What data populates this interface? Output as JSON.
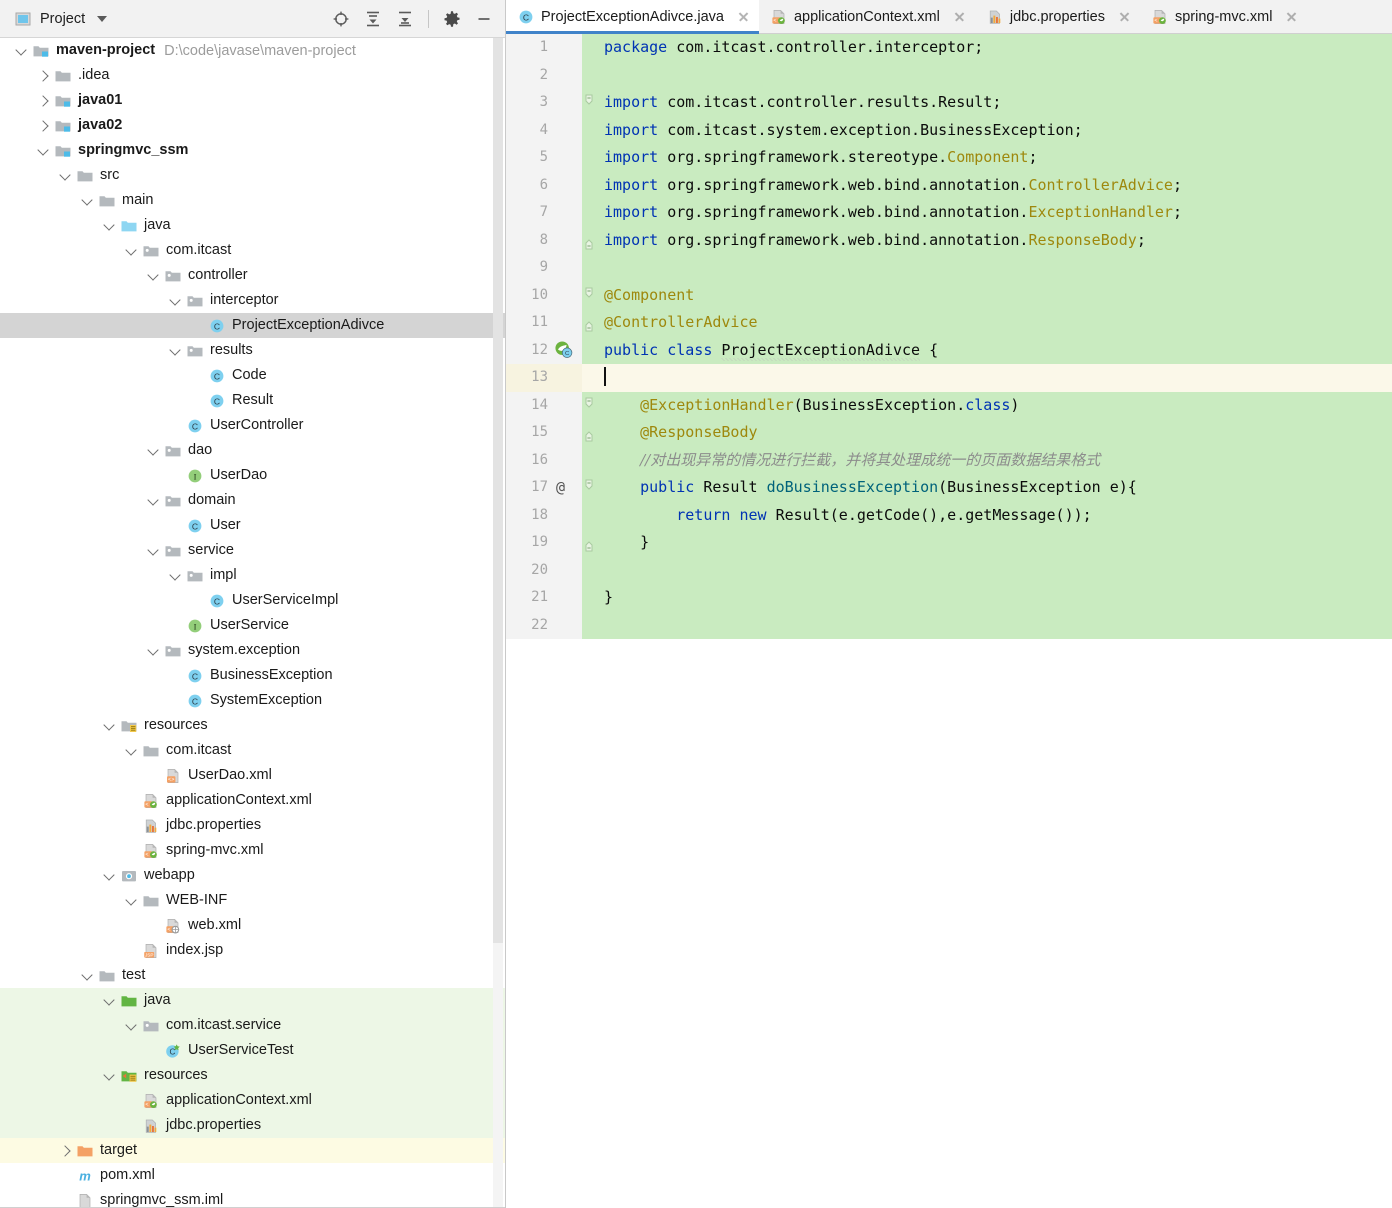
{
  "project_panel": {
    "header": {
      "title": "Project",
      "icon": "project-window-icon",
      "dropdown_icon": "chevron-down-icon",
      "tools": [
        {
          "name": "locate-in-tree-icon",
          "label": "Select Opened File"
        },
        {
          "name": "expand-all-icon",
          "label": "Expand All"
        },
        {
          "name": "collapse-all-icon",
          "label": "Collapse All"
        },
        {
          "name": "settings-gear-icon",
          "label": "Settings"
        },
        {
          "name": "hide-panel-icon",
          "label": "Hide"
        }
      ]
    },
    "tree": [
      {
        "label": "maven-project",
        "path": "D:\\code\\javase\\maven-project",
        "depth": 0,
        "twisty": "open",
        "icon": "module-folder-icon",
        "bold": true,
        "tint": ""
      },
      {
        "label": ".idea",
        "path": "",
        "depth": 1,
        "twisty": "closed",
        "icon": "folder-icon",
        "bold": false,
        "tint": ""
      },
      {
        "label": "java01",
        "path": "",
        "depth": 1,
        "twisty": "closed",
        "icon": "module-folder-icon",
        "bold": true,
        "tint": ""
      },
      {
        "label": "java02",
        "path": "",
        "depth": 1,
        "twisty": "closed",
        "icon": "module-folder-icon",
        "bold": true,
        "tint": ""
      },
      {
        "label": "springmvc_ssm",
        "path": "",
        "depth": 1,
        "twisty": "open",
        "icon": "module-folder-icon",
        "bold": true,
        "tint": ""
      },
      {
        "label": "src",
        "path": "",
        "depth": 2,
        "twisty": "open",
        "icon": "folder-icon",
        "bold": false,
        "tint": ""
      },
      {
        "label": "main",
        "path": "",
        "depth": 3,
        "twisty": "open",
        "icon": "folder-icon",
        "bold": false,
        "tint": ""
      },
      {
        "label": "java",
        "path": "",
        "depth": 4,
        "twisty": "open",
        "icon": "source-root-folder-icon",
        "bold": false,
        "tint": ""
      },
      {
        "label": "com.itcast",
        "path": "",
        "depth": 5,
        "twisty": "open",
        "icon": "package-folder-icon",
        "bold": false,
        "tint": ""
      },
      {
        "label": "controller",
        "path": "",
        "depth": 6,
        "twisty": "open",
        "icon": "package-folder-icon",
        "bold": false,
        "tint": ""
      },
      {
        "label": "interceptor",
        "path": "",
        "depth": 7,
        "twisty": "open",
        "icon": "package-folder-icon",
        "bold": false,
        "tint": ""
      },
      {
        "label": "ProjectExceptionAdivce",
        "path": "",
        "depth": 8,
        "twisty": "none",
        "icon": "java-class-icon",
        "bold": false,
        "tint": "selected"
      },
      {
        "label": "results",
        "path": "",
        "depth": 7,
        "twisty": "open",
        "icon": "package-folder-icon",
        "bold": false,
        "tint": ""
      },
      {
        "label": "Code",
        "path": "",
        "depth": 8,
        "twisty": "none",
        "icon": "java-class-icon",
        "bold": false,
        "tint": ""
      },
      {
        "label": "Result",
        "path": "",
        "depth": 8,
        "twisty": "none",
        "icon": "java-class-icon",
        "bold": false,
        "tint": ""
      },
      {
        "label": "UserController",
        "path": "",
        "depth": 7,
        "twisty": "none",
        "icon": "java-class-icon",
        "bold": false,
        "tint": ""
      },
      {
        "label": "dao",
        "path": "",
        "depth": 6,
        "twisty": "open",
        "icon": "package-folder-icon",
        "bold": false,
        "tint": ""
      },
      {
        "label": "UserDao",
        "path": "",
        "depth": 7,
        "twisty": "none",
        "icon": "java-interface-icon",
        "bold": false,
        "tint": ""
      },
      {
        "label": "domain",
        "path": "",
        "depth": 6,
        "twisty": "open",
        "icon": "package-folder-icon",
        "bold": false,
        "tint": ""
      },
      {
        "label": "User",
        "path": "",
        "depth": 7,
        "twisty": "none",
        "icon": "java-class-icon",
        "bold": false,
        "tint": ""
      },
      {
        "label": "service",
        "path": "",
        "depth": 6,
        "twisty": "open",
        "icon": "package-folder-icon",
        "bold": false,
        "tint": ""
      },
      {
        "label": "impl",
        "path": "",
        "depth": 7,
        "twisty": "open",
        "icon": "package-folder-icon",
        "bold": false,
        "tint": ""
      },
      {
        "label": "UserServiceImpl",
        "path": "",
        "depth": 8,
        "twisty": "none",
        "icon": "java-class-icon",
        "bold": false,
        "tint": ""
      },
      {
        "label": "UserService",
        "path": "",
        "depth": 7,
        "twisty": "none",
        "icon": "java-interface-icon",
        "bold": false,
        "tint": ""
      },
      {
        "label": "system.exception",
        "path": "",
        "depth": 6,
        "twisty": "open",
        "icon": "package-folder-icon",
        "bold": false,
        "tint": ""
      },
      {
        "label": "BusinessException",
        "path": "",
        "depth": 7,
        "twisty": "none",
        "icon": "java-class-icon",
        "bold": false,
        "tint": ""
      },
      {
        "label": "SystemException",
        "path": "",
        "depth": 7,
        "twisty": "none",
        "icon": "java-class-icon",
        "bold": false,
        "tint": ""
      },
      {
        "label": "resources",
        "path": "",
        "depth": 4,
        "twisty": "open",
        "icon": "resource-root-folder-icon",
        "bold": false,
        "tint": ""
      },
      {
        "label": "com.itcast",
        "path": "",
        "depth": 5,
        "twisty": "open",
        "icon": "folder-icon",
        "bold": false,
        "tint": ""
      },
      {
        "label": "UserDao.xml",
        "path": "",
        "depth": 6,
        "twisty": "none",
        "icon": "xml-file-icon",
        "bold": false,
        "tint": ""
      },
      {
        "label": "applicationContext.xml",
        "path": "",
        "depth": 5,
        "twisty": "none",
        "icon": "spring-xml-file-icon",
        "bold": false,
        "tint": ""
      },
      {
        "label": "jdbc.properties",
        "path": "",
        "depth": 5,
        "twisty": "none",
        "icon": "properties-file-icon",
        "bold": false,
        "tint": ""
      },
      {
        "label": "spring-mvc.xml",
        "path": "",
        "depth": 5,
        "twisty": "none",
        "icon": "spring-xml-file-icon",
        "bold": false,
        "tint": ""
      },
      {
        "label": "webapp",
        "path": "",
        "depth": 4,
        "twisty": "open",
        "icon": "web-root-folder-icon",
        "bold": false,
        "tint": ""
      },
      {
        "label": "WEB-INF",
        "path": "",
        "depth": 5,
        "twisty": "open",
        "icon": "folder-icon",
        "bold": false,
        "tint": ""
      },
      {
        "label": "web.xml",
        "path": "",
        "depth": 6,
        "twisty": "none",
        "icon": "web-xml-file-icon",
        "bold": false,
        "tint": ""
      },
      {
        "label": "index.jsp",
        "path": "",
        "depth": 5,
        "twisty": "none",
        "icon": "jsp-file-icon",
        "bold": false,
        "tint": ""
      },
      {
        "label": "test",
        "path": "",
        "depth": 3,
        "twisty": "open",
        "icon": "folder-icon",
        "bold": false,
        "tint": ""
      },
      {
        "label": "java",
        "path": "",
        "depth": 4,
        "twisty": "open",
        "icon": "test-source-root-folder-icon",
        "bold": false,
        "tint": "green"
      },
      {
        "label": "com.itcast.service",
        "path": "",
        "depth": 5,
        "twisty": "open",
        "icon": "package-folder-icon",
        "bold": false,
        "tint": "green"
      },
      {
        "label": "UserServiceTest",
        "path": "",
        "depth": 6,
        "twisty": "none",
        "icon": "java-test-class-icon",
        "bold": false,
        "tint": "green"
      },
      {
        "label": "resources",
        "path": "",
        "depth": 4,
        "twisty": "open",
        "icon": "test-resource-root-folder-icon",
        "bold": false,
        "tint": "green"
      },
      {
        "label": "applicationContext.xml",
        "path": "",
        "depth": 5,
        "twisty": "none",
        "icon": "spring-xml-file-icon",
        "bold": false,
        "tint": "green"
      },
      {
        "label": "jdbc.properties",
        "path": "",
        "depth": 5,
        "twisty": "none",
        "icon": "properties-file-icon",
        "bold": false,
        "tint": "green"
      },
      {
        "label": "target",
        "path": "",
        "depth": 2,
        "twisty": "closed",
        "icon": "excluded-folder-icon",
        "bold": false,
        "tint": "yellow"
      },
      {
        "label": "pom.xml",
        "path": "",
        "depth": 2,
        "twisty": "none",
        "icon": "maven-pom-icon",
        "bold": false,
        "tint": ""
      },
      {
        "label": "springmvc_ssm.iml",
        "path": "",
        "depth": 2,
        "twisty": "none",
        "icon": "iml-file-icon",
        "bold": false,
        "tint": ""
      }
    ]
  },
  "editor": {
    "tabs": [
      {
        "label": "ProjectExceptionAdivce.java",
        "icon": "java-class-icon",
        "active": true
      },
      {
        "label": "applicationContext.xml",
        "icon": "spring-xml-file-icon",
        "active": false
      },
      {
        "label": "jdbc.properties",
        "icon": "properties-file-icon",
        "active": false
      },
      {
        "label": "spring-mvc.xml",
        "icon": "spring-xml-file-icon",
        "active": false
      }
    ],
    "close_icon": "close-icon",
    "active_tab_accent": "#4083c9",
    "changed_lines_color": "#c9ebc0",
    "caret_line_color": "#fbf8e9",
    "lines": [
      {
        "n": "1",
        "bg": "green",
        "fold": "",
        "gmark": "",
        "html": "<span class=\"kw\">package</span> com.itcast.controller.interceptor;"
      },
      {
        "n": "2",
        "bg": "green",
        "fold": "",
        "gmark": "",
        "html": ""
      },
      {
        "n": "3",
        "bg": "green",
        "fold": "start",
        "gmark": "",
        "html": "<span class=\"kw\">import</span> com.itcast.controller.results.Result;"
      },
      {
        "n": "4",
        "bg": "green",
        "fold": "",
        "gmark": "",
        "html": "<span class=\"kw\">import</span> com.itcast.system.exception.BusinessException;"
      },
      {
        "n": "5",
        "bg": "green",
        "fold": "",
        "gmark": "",
        "html": "<span class=\"kw\">import</span> org.springframework.stereotype.<span class=\"anno\">Component</span>;"
      },
      {
        "n": "6",
        "bg": "green",
        "fold": "",
        "gmark": "",
        "html": "<span class=\"kw\">import</span> org.springframework.web.bind.annotation.<span class=\"anno\">ControllerAdvice</span>;"
      },
      {
        "n": "7",
        "bg": "green",
        "fold": "",
        "gmark": "",
        "html": "<span class=\"kw\">import</span> org.springframework.web.bind.annotation.<span class=\"anno\">ExceptionHandler</span>;"
      },
      {
        "n": "8",
        "bg": "green",
        "fold": "end",
        "gmark": "",
        "html": "<span class=\"kw\">import</span> org.springframework.web.bind.annotation.<span class=\"anno\">ResponseBody</span>;"
      },
      {
        "n": "9",
        "bg": "green",
        "fold": "",
        "gmark": "",
        "html": ""
      },
      {
        "n": "10",
        "bg": "green",
        "fold": "start",
        "gmark": "",
        "html": "<span class=\"anno\">@Component</span>"
      },
      {
        "n": "11",
        "bg": "green",
        "fold": "end",
        "gmark": "",
        "html": "<span class=\"anno\">@ControllerAdvice</span>"
      },
      {
        "n": "12",
        "bg": "green",
        "fold": "",
        "gmark": "spring-bean-icon",
        "html": "<span class=\"kw\">public</span> <span class=\"kw\">class</span> <span class=\"cls typo\">ProjectExceptionAdivce</span> {"
      },
      {
        "n": "13",
        "bg": "caret",
        "fold": "",
        "gmark": "",
        "html": "<span class=\"caret\"></span>"
      },
      {
        "n": "14",
        "bg": "green",
        "fold": "start",
        "gmark": "",
        "html": "    <span class=\"anno\">@ExceptionHandler</span>(BusinessException.<span class=\"kw\">class</span>)"
      },
      {
        "n": "15",
        "bg": "green",
        "fold": "end",
        "gmark": "",
        "html": "    <span class=\"anno\">@ResponseBody</span>"
      },
      {
        "n": "16",
        "bg": "green",
        "fold": "",
        "gmark": "",
        "html": "    <span class=\"cmt\">//对出现异常的情况进行拦截，并将其处理成统一的页面数据结果格式</span>"
      },
      {
        "n": "17",
        "bg": "green",
        "fold": "start",
        "gmark": "override-marker",
        "html": "    <span class=\"kw\">public</span> Result <span class=\"meth\">doBusinessException</span>(BusinessException e){"
      },
      {
        "n": "18",
        "bg": "green",
        "fold": "",
        "gmark": "",
        "html": "        <span class=\"kw\">return</span> <span class=\"kw\">new</span> Result(e.getCode(),e.getMessage());"
      },
      {
        "n": "19",
        "bg": "green",
        "fold": "end",
        "gmark": "",
        "html": "    }"
      },
      {
        "n": "20",
        "bg": "green",
        "fold": "",
        "gmark": "",
        "html": ""
      },
      {
        "n": "21",
        "bg": "green",
        "fold": "",
        "gmark": "",
        "html": "}"
      },
      {
        "n": "22",
        "bg": "green",
        "fold": "",
        "gmark": "",
        "html": ""
      }
    ]
  }
}
